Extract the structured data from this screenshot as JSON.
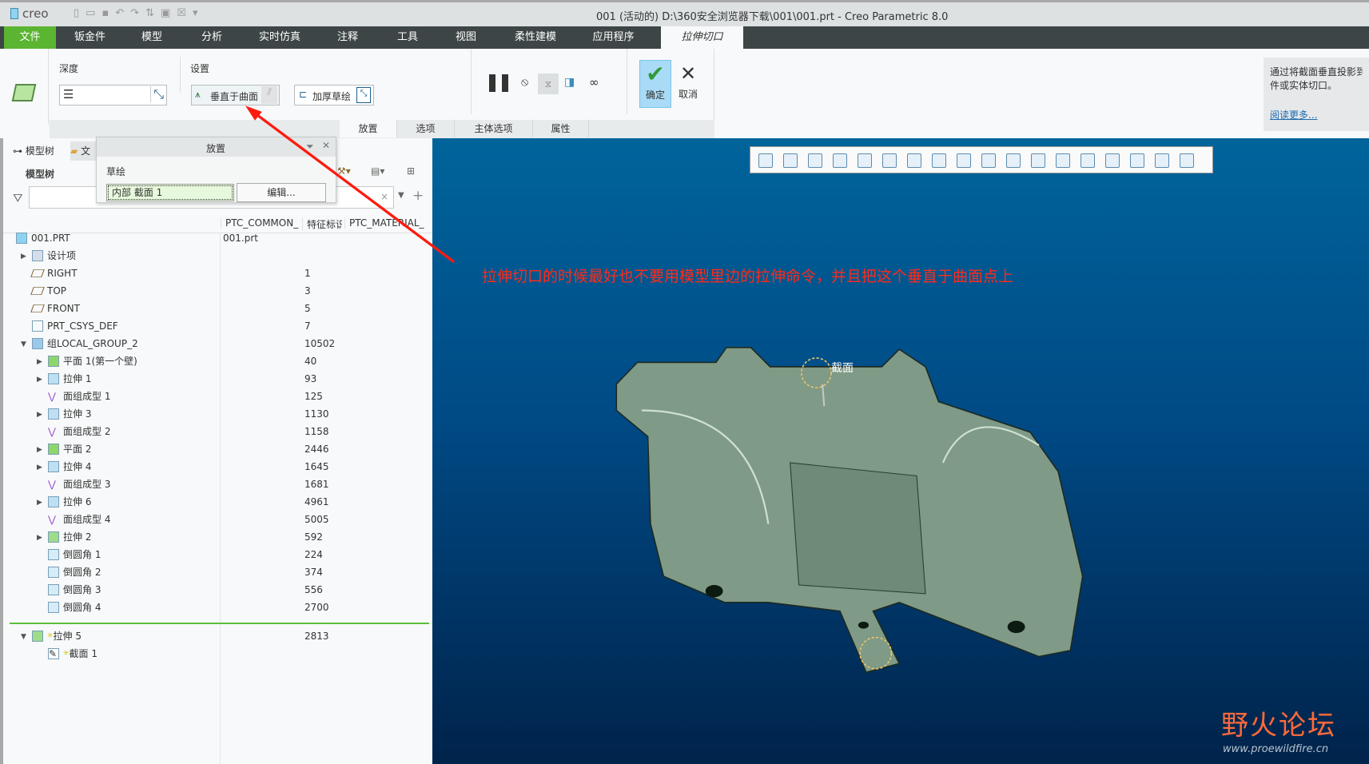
{
  "titlebar": {
    "app_logo": "creo",
    "title": "001 (活动的) D:\\360安全浏览器下载\\001\\001.prt - Creo Parametric 8.0"
  },
  "menu": {
    "items": [
      "文件",
      "钣金件",
      "模型",
      "分析",
      "实时仿真",
      "注释",
      "工具",
      "视图",
      "柔性建模",
      "应用程序"
    ],
    "active_tab": "拉伸切口"
  },
  "ribbon": {
    "depth_label": "深度",
    "depth_value": "",
    "settings_label": "设置",
    "normal_to_surface": "垂直于曲面",
    "thicken_sketch": "加厚草绘",
    "ok": "确定",
    "cancel": "取消",
    "subtabs": [
      "放置",
      "选项",
      "主体选项",
      "属性"
    ]
  },
  "help": {
    "text": "通过将截面垂直投影到曲面或实体切口。",
    "line1": "通过将截面垂直投影到面",
    "line2": "件或实体切口。",
    "link": "阅读更多..."
  },
  "panel": {
    "tabs": [
      "模型树",
      "文"
    ],
    "tree_title": "模型树",
    "filter_placeholder": "",
    "columns": [
      "PTC_COMMON_",
      "特征标识",
      "PTC_MATERIAL_"
    ]
  },
  "popup": {
    "title": "放置",
    "sketch_label": "草绘",
    "sketch_value": "内部 截面 1",
    "edit": "编辑..."
  },
  "tree": [
    {
      "label": "001.PRT",
      "common": "001.prt",
      "id": "",
      "level": 0,
      "exp": "",
      "icon": "part-icon"
    },
    {
      "label": "设计项",
      "id": "",
      "level": 1,
      "exp": "▶",
      "icon": "design-items-icon"
    },
    {
      "label": "RIGHT",
      "id": "1",
      "level": 1,
      "exp": "",
      "icon": "datum-plane-icon"
    },
    {
      "label": "TOP",
      "id": "3",
      "level": 1,
      "exp": "",
      "icon": "datum-plane-icon"
    },
    {
      "label": "FRONT",
      "id": "5",
      "level": 1,
      "exp": "",
      "icon": "datum-plane-icon"
    },
    {
      "label": "PRT_CSYS_DEF",
      "id": "7",
      "level": 1,
      "exp": "",
      "icon": "csys-icon"
    },
    {
      "label": "组LOCAL_GROUP_2",
      "id": "10502",
      "level": 1,
      "exp": "▼",
      "icon": "group-icon"
    },
    {
      "label": "平面 1(第一个壁)",
      "id": "40",
      "level": 2,
      "exp": "▶",
      "icon": "planar-wall-icon"
    },
    {
      "label": "拉伸 1",
      "id": "93",
      "level": 2,
      "exp": "▶",
      "icon": "extrude-icon"
    },
    {
      "label": "面组成型 1",
      "id": "125",
      "level": 2,
      "exp": "",
      "icon": "quilt-form-icon"
    },
    {
      "label": "拉伸 3",
      "id": "1130",
      "level": 2,
      "exp": "▶",
      "icon": "extrude-icon"
    },
    {
      "label": "面组成型 2",
      "id": "1158",
      "level": 2,
      "exp": "",
      "icon": "quilt-form-icon"
    },
    {
      "label": "平面 2",
      "id": "2446",
      "level": 2,
      "exp": "▶",
      "icon": "planar-wall-icon"
    },
    {
      "label": "拉伸 4",
      "id": "1645",
      "level": 2,
      "exp": "▶",
      "icon": "extrude-icon"
    },
    {
      "label": "面组成型 3",
      "id": "1681",
      "level": 2,
      "exp": "",
      "icon": "quilt-form-icon"
    },
    {
      "label": "拉伸 6",
      "id": "4961",
      "level": 2,
      "exp": "▶",
      "icon": "extrude-icon"
    },
    {
      "label": "面组成型 4",
      "id": "5005",
      "level": 2,
      "exp": "",
      "icon": "quilt-form-icon"
    },
    {
      "label": "拉伸 2",
      "id": "592",
      "level": 2,
      "exp": "▶",
      "icon": "extrude-cut-icon"
    },
    {
      "label": "倒圆角 1",
      "id": "224",
      "level": 2,
      "exp": "",
      "icon": "round-icon"
    },
    {
      "label": "倒圆角 2",
      "id": "374",
      "level": 2,
      "exp": "",
      "icon": "round-icon"
    },
    {
      "label": "倒圆角 3",
      "id": "556",
      "level": 2,
      "exp": "",
      "icon": "round-icon"
    },
    {
      "label": "倒圆角 4",
      "id": "2700",
      "level": 2,
      "exp": "",
      "icon": "round-icon"
    }
  ],
  "active_tree": [
    {
      "label": "拉伸 5",
      "id": "2813",
      "level": 1,
      "exp": "▼",
      "icon": "extrude-cut-icon",
      "new": "✳"
    },
    {
      "label": "截面 1",
      "id": "",
      "level": 2,
      "exp": "",
      "icon": "sketch-icon",
      "new": "✳"
    }
  ],
  "viewport": {
    "annotation": "拉伸切口的时候最好也不要用模型里边的拉伸命令，并且把这个垂直于曲面点上",
    "section_label": "截面"
  },
  "watermark": {
    "text": "野火论坛",
    "url": "www.proewildfire.cn"
  },
  "colors": {
    "menu_bg": "#3d4546",
    "file_tab": "#5cb531",
    "annotation": "#ff2a1a",
    "viewport_top": "#00649b",
    "viewport_bottom": "#00234b",
    "model": "#7f9a86"
  }
}
